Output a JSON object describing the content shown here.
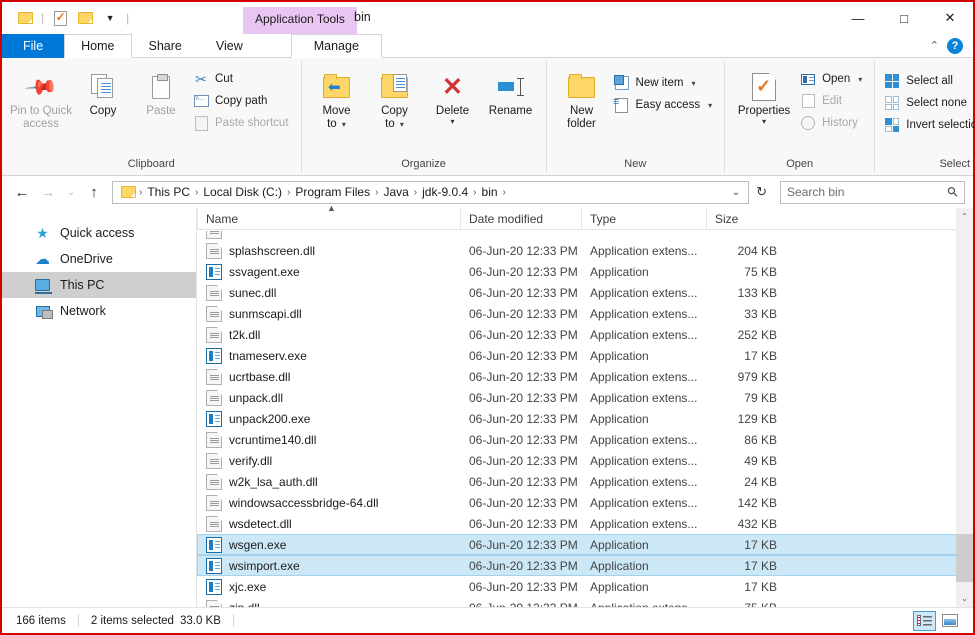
{
  "window": {
    "title": "bin",
    "contextual_tab": "Application Tools",
    "minimize_label": "—",
    "maximize_label": "□",
    "close_label": "✕"
  },
  "quick_access_toolbar": {
    "items": [
      {
        "name": "folder-icon",
        "label": ""
      },
      {
        "name": "properties-icon",
        "label": ""
      },
      {
        "name": "new-folder-icon",
        "label": ""
      },
      {
        "name": "customize-caret",
        "label": "▼"
      }
    ]
  },
  "tabs": [
    {
      "id": "file",
      "label": "File"
    },
    {
      "id": "home",
      "label": "Home"
    },
    {
      "id": "share",
      "label": "Share"
    },
    {
      "id": "view",
      "label": "View"
    },
    {
      "id": "manage",
      "label": "Manage"
    }
  ],
  "ribbon_controls": {
    "collapse_label": "⌃",
    "help_label": "?"
  },
  "ribbon": {
    "groups": [
      {
        "title": "Clipboard",
        "big_buttons": [
          {
            "label": "Pin to Quick\naccess",
            "line1": "Pin to Quick",
            "line2": "access",
            "disabled": true
          },
          {
            "label": "Copy",
            "line1": "Copy",
            "line2": "",
            "disabled": false
          },
          {
            "label": "Paste",
            "line1": "Paste",
            "line2": "",
            "disabled": true
          }
        ],
        "small_buttons": [
          {
            "label": "Cut",
            "disabled": false
          },
          {
            "label": "Copy path",
            "disabled": false
          },
          {
            "label": "Paste shortcut",
            "disabled": true
          }
        ]
      },
      {
        "title": "Organize",
        "big_buttons": [
          {
            "line1": "Move",
            "line2": "to",
            "has_caret": true
          },
          {
            "line1": "Copy",
            "line2": "to",
            "has_caret": true
          },
          {
            "line1": "Delete",
            "line2": "",
            "has_caret": true
          },
          {
            "line1": "Rename",
            "line2": "",
            "has_caret": false
          }
        ]
      },
      {
        "title": "New",
        "big_buttons": [
          {
            "line1": "New",
            "line2": "folder",
            "has_caret": false
          }
        ],
        "small_buttons": [
          {
            "label": "New item",
            "has_caret": true
          },
          {
            "label": "Easy access",
            "has_caret": true
          }
        ]
      },
      {
        "title": "Open",
        "big_buttons": [
          {
            "line1": "Properties",
            "line2": "",
            "has_caret": true
          }
        ],
        "small_buttons": [
          {
            "label": "Open",
            "has_caret": true,
            "disabled": false
          },
          {
            "label": "Edit",
            "has_caret": false,
            "disabled": true
          },
          {
            "label": "History",
            "has_caret": false,
            "disabled": true
          }
        ]
      },
      {
        "title": "Select",
        "small_buttons": [
          {
            "label": "Select all"
          },
          {
            "label": "Select none"
          },
          {
            "label": "Invert selection"
          }
        ]
      }
    ]
  },
  "address_bar": {
    "back_label": "←",
    "forward_label": "→",
    "recent_label": "⌄",
    "up_label": "↑",
    "breadcrumbs": [
      "This PC",
      "Local Disk (C:)",
      "Program Files",
      "Java",
      "jdk-9.0.4",
      "bin"
    ],
    "separator": "›",
    "dropdown_label": "⌄",
    "refresh_label": "↻",
    "search_placeholder": "Search bin",
    "search_value": ""
  },
  "navigation_pane": {
    "items": [
      {
        "label": "Quick access",
        "icon": "star-icon",
        "selected": false
      },
      {
        "label": "OneDrive",
        "icon": "cloud-icon",
        "selected": false
      },
      {
        "label": "This PC",
        "icon": "computer-icon",
        "selected": true
      },
      {
        "label": "Network",
        "icon": "network-icon",
        "selected": false
      }
    ]
  },
  "file_list": {
    "columns": [
      "Name",
      "Date modified",
      "Type",
      "Size"
    ],
    "sort_column": "Name",
    "sort_direction": "ascending",
    "rows": [
      {
        "name": "splashscreen.dll",
        "date": "06-Jun-20 12:33 PM",
        "type": "Application extens...",
        "size": "204 KB",
        "kind": "dll",
        "selected": false
      },
      {
        "name": "ssvagent.exe",
        "date": "06-Jun-20 12:33 PM",
        "type": "Application",
        "size": "75 KB",
        "kind": "exe",
        "selected": false
      },
      {
        "name": "sunec.dll",
        "date": "06-Jun-20 12:33 PM",
        "type": "Application extens...",
        "size": "133 KB",
        "kind": "dll",
        "selected": false
      },
      {
        "name": "sunmscapi.dll",
        "date": "06-Jun-20 12:33 PM",
        "type": "Application extens...",
        "size": "33 KB",
        "kind": "dll",
        "selected": false
      },
      {
        "name": "t2k.dll",
        "date": "06-Jun-20 12:33 PM",
        "type": "Application extens...",
        "size": "252 KB",
        "kind": "dll",
        "selected": false
      },
      {
        "name": "tnameserv.exe",
        "date": "06-Jun-20 12:33 PM",
        "type": "Application",
        "size": "17 KB",
        "kind": "exe",
        "selected": false
      },
      {
        "name": "ucrtbase.dll",
        "date": "06-Jun-20 12:33 PM",
        "type": "Application extens...",
        "size": "979 KB",
        "kind": "dll",
        "selected": false
      },
      {
        "name": "unpack.dll",
        "date": "06-Jun-20 12:33 PM",
        "type": "Application extens...",
        "size": "79 KB",
        "kind": "dll",
        "selected": false
      },
      {
        "name": "unpack200.exe",
        "date": "06-Jun-20 12:33 PM",
        "type": "Application",
        "size": "129 KB",
        "kind": "exe",
        "selected": false
      },
      {
        "name": "vcruntime140.dll",
        "date": "06-Jun-20 12:33 PM",
        "type": "Application extens...",
        "size": "86 KB",
        "kind": "dll",
        "selected": false
      },
      {
        "name": "verify.dll",
        "date": "06-Jun-20 12:33 PM",
        "type": "Application extens...",
        "size": "49 KB",
        "kind": "dll",
        "selected": false
      },
      {
        "name": "w2k_lsa_auth.dll",
        "date": "06-Jun-20 12:33 PM",
        "type": "Application extens...",
        "size": "24 KB",
        "kind": "dll",
        "selected": false
      },
      {
        "name": "windowsaccessbridge-64.dll",
        "date": "06-Jun-20 12:33 PM",
        "type": "Application extens...",
        "size": "142 KB",
        "kind": "dll",
        "selected": false
      },
      {
        "name": "wsdetect.dll",
        "date": "06-Jun-20 12:33 PM",
        "type": "Application extens...",
        "size": "432 KB",
        "kind": "dll",
        "selected": false
      },
      {
        "name": "wsgen.exe",
        "date": "06-Jun-20 12:33 PM",
        "type": "Application",
        "size": "17 KB",
        "kind": "exe",
        "selected": true
      },
      {
        "name": "wsimport.exe",
        "date": "06-Jun-20 12:33 PM",
        "type": "Application",
        "size": "17 KB",
        "kind": "exe",
        "selected": true
      },
      {
        "name": "xjc.exe",
        "date": "06-Jun-20 12:33 PM",
        "type": "Application",
        "size": "17 KB",
        "kind": "exe",
        "selected": false
      },
      {
        "name": "zip.dll",
        "date": "06-Jun-20 12:33 PM",
        "type": "Application extens...",
        "size": "75 KB",
        "kind": "dll",
        "selected": false
      }
    ]
  },
  "scrollbar": {
    "up_label": "⌃",
    "down_label": "⌄"
  },
  "status_bar": {
    "item_count": "166 items",
    "selection": "2 items selected",
    "selection_size": "33.0 KB",
    "view_details_label": "",
    "view_tiles_label": ""
  },
  "colors": {
    "accent": "#0078d7",
    "contextual_tab": "#e9c6f2",
    "selection": "#cce8f7",
    "selection_border": "#a3d2ef",
    "nav_selected": "#cfcfcf"
  }
}
